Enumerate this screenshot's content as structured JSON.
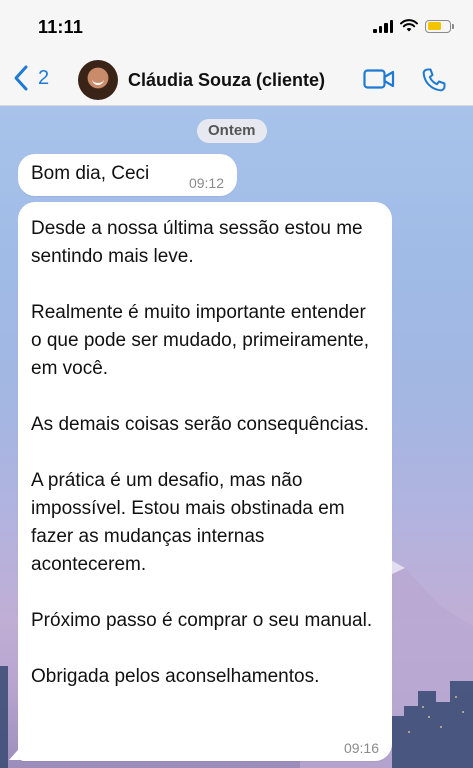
{
  "status_bar": {
    "time": "11:11",
    "battery_level": 0.55,
    "battery_color": "#f4c400"
  },
  "nav": {
    "back_count": "2",
    "contact_name": "Cláudia Souza (cliente)",
    "accent_color": "#1e7ad2",
    "icons": [
      "chevron-left-icon",
      "video-camera-icon",
      "phone-icon"
    ]
  },
  "chat": {
    "date_label": "Ontem",
    "messages": [
      {
        "text": "Bom dia, Ceci",
        "time": "09:12"
      },
      {
        "paragraphs": [
          "Desde a nossa última sessão estou me sentindo mais leve.",
          "Realmente é muito importante entender o que pode ser mudado, primeiramente, em você.",
          "As demais coisas serão consequências.",
          "A prática é um desafio, mas não impossível. Estou mais obstinada em fazer as mudanças internas acontecerem.",
          "Próximo passo é comprar o seu manual.",
          "Obrigada pelos aconselhamentos."
        ],
        "time": "09:16"
      }
    ]
  }
}
